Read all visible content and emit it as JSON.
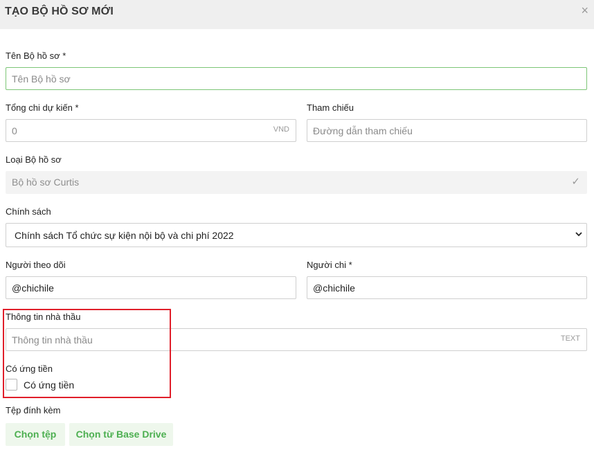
{
  "dialog": {
    "title": "TẠO BỘ HỒ SƠ MỚI",
    "close_icon": "×"
  },
  "fields": {
    "name": {
      "label": "Tên Bộ hồ sơ *",
      "placeholder": "Tên Bộ hồ sơ"
    },
    "budget": {
      "label": "Tổng chi dự kiến *",
      "placeholder": "0",
      "suffix": "VND"
    },
    "reference": {
      "label": "Tham chiếu",
      "placeholder": "Đường dẫn tham chiếu"
    },
    "type": {
      "label": "Loại Bộ hồ sơ",
      "value": "Bộ hồ sơ Curtis",
      "check_icon": "✓"
    },
    "policy": {
      "label": "Chính sách",
      "value": "Chính sách Tổ chức sự kiện nội bộ và chi phí 2022"
    },
    "followers": {
      "label": "Người theo dõi",
      "value": "@chichile"
    },
    "spender": {
      "label": "Người chi *",
      "value": "@chichile"
    },
    "contractor": {
      "label": "Thông tin nhà thầu",
      "placeholder": "Thông tin nhà thầu",
      "suffix": "TEXT"
    },
    "advance": {
      "label": "Có ứng tiền",
      "checkbox_label": "Có ứng tiền",
      "checked": false
    },
    "attachments": {
      "label": "Tệp đính kèm"
    }
  },
  "buttons": {
    "choose_file": "Chọn tệp",
    "choose_drive": "Chọn từ Base Drive"
  },
  "colors": {
    "accent_green": "#4caf50",
    "highlight_red": "#e01e2a"
  }
}
